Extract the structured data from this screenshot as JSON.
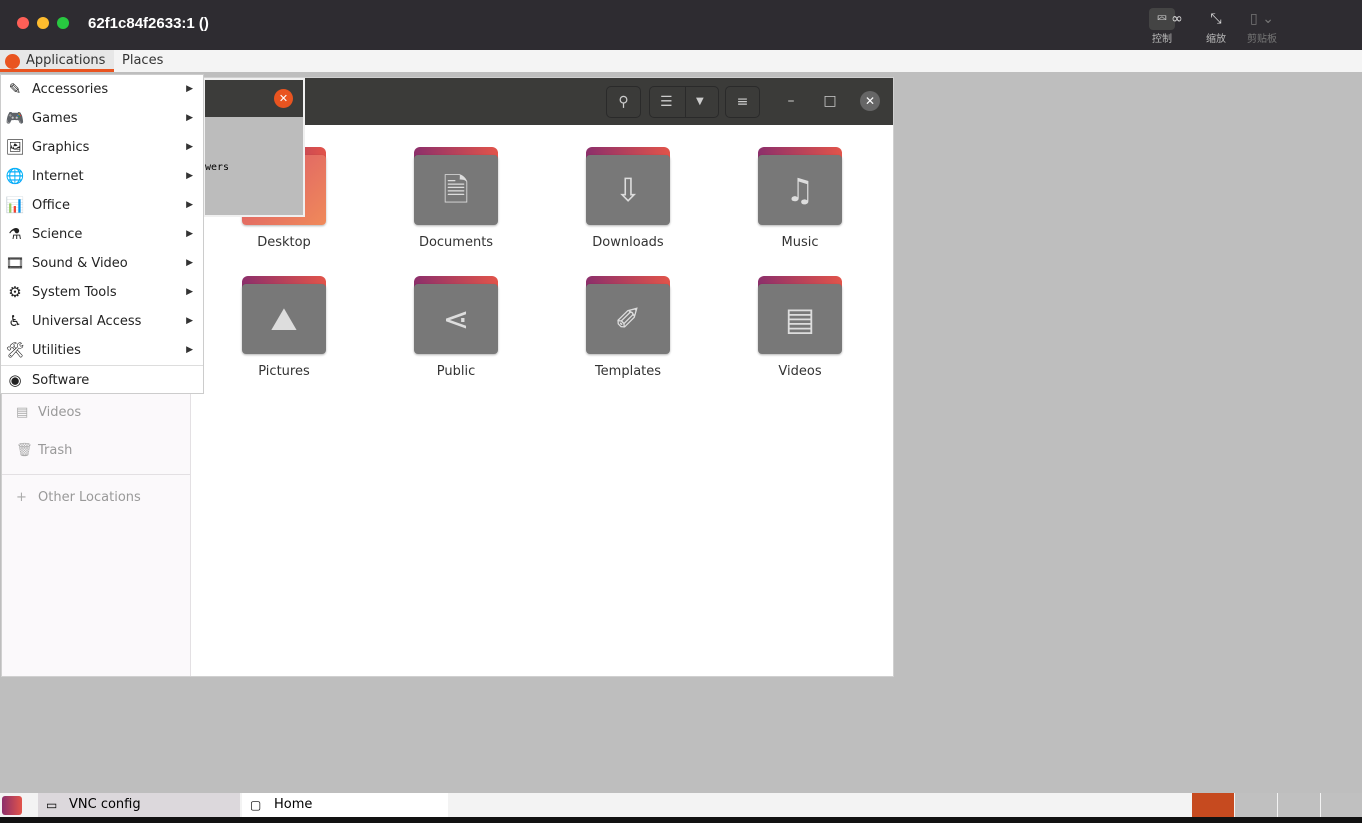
{
  "window": {
    "title": "62f1c84f2633:1 ()"
  },
  "toolbar": {
    "control": "控制",
    "zoom": "缩放",
    "clipboard": "剪贴板"
  },
  "top_panel": {
    "applications": "Applications",
    "places": "Places"
  },
  "menu": {
    "items": [
      {
        "label": "Accessories",
        "icon": "accessories-icon",
        "glyph": "✎",
        "submenu": true
      },
      {
        "label": "Games",
        "icon": "games-icon",
        "glyph": "🎮",
        "submenu": true
      },
      {
        "label": "Graphics",
        "icon": "graphics-icon",
        "glyph": "🖼",
        "submenu": true
      },
      {
        "label": "Internet",
        "icon": "globe-icon",
        "glyph": "🌐",
        "submenu": true
      },
      {
        "label": "Office",
        "icon": "office-icon",
        "glyph": "📊",
        "submenu": true
      },
      {
        "label": "Science",
        "icon": "flask-icon",
        "glyph": "⚗",
        "submenu": true
      },
      {
        "label": "Sound & Video",
        "icon": "film-icon",
        "glyph": "🎞",
        "submenu": true
      },
      {
        "label": "System Tools",
        "icon": "gear-icon",
        "glyph": "⚙",
        "submenu": true
      },
      {
        "label": "Universal Access",
        "icon": "accessibility-icon",
        "glyph": "♿",
        "submenu": true
      },
      {
        "label": "Utilities",
        "icon": "utilities-icon",
        "glyph": "🛠",
        "submenu": true
      },
      {
        "label": "Software",
        "icon": "software-icon",
        "glyph": "◉",
        "submenu": false
      }
    ]
  },
  "dialog": {
    "partial_text": "wers"
  },
  "sidebar": {
    "items": [
      {
        "label": "Videos",
        "glyph": "▤"
      },
      {
        "label": "Trash",
        "glyph": "🗑"
      },
      {
        "label": "Other Locations",
        "glyph": "+"
      }
    ]
  },
  "folders": [
    {
      "label": "Desktop",
      "glyph": ""
    },
    {
      "label": "Documents",
      "glyph": "🗎"
    },
    {
      "label": "Downloads",
      "glyph": "⇩"
    },
    {
      "label": "Music",
      "glyph": "♫"
    },
    {
      "label": "Pictures",
      "glyph": "⛰"
    },
    {
      "label": "Public",
      "glyph": "⋖"
    },
    {
      "label": "Templates",
      "glyph": "✐"
    },
    {
      "label": "Videos",
      "glyph": "▤"
    }
  ],
  "taskbar": {
    "tasks": [
      {
        "label": "VNC config"
      },
      {
        "label": "Home"
      }
    ]
  },
  "colors": {
    "accent": "#e95420",
    "titlebar": "#2e2c31",
    "header": "#3b3b39"
  }
}
